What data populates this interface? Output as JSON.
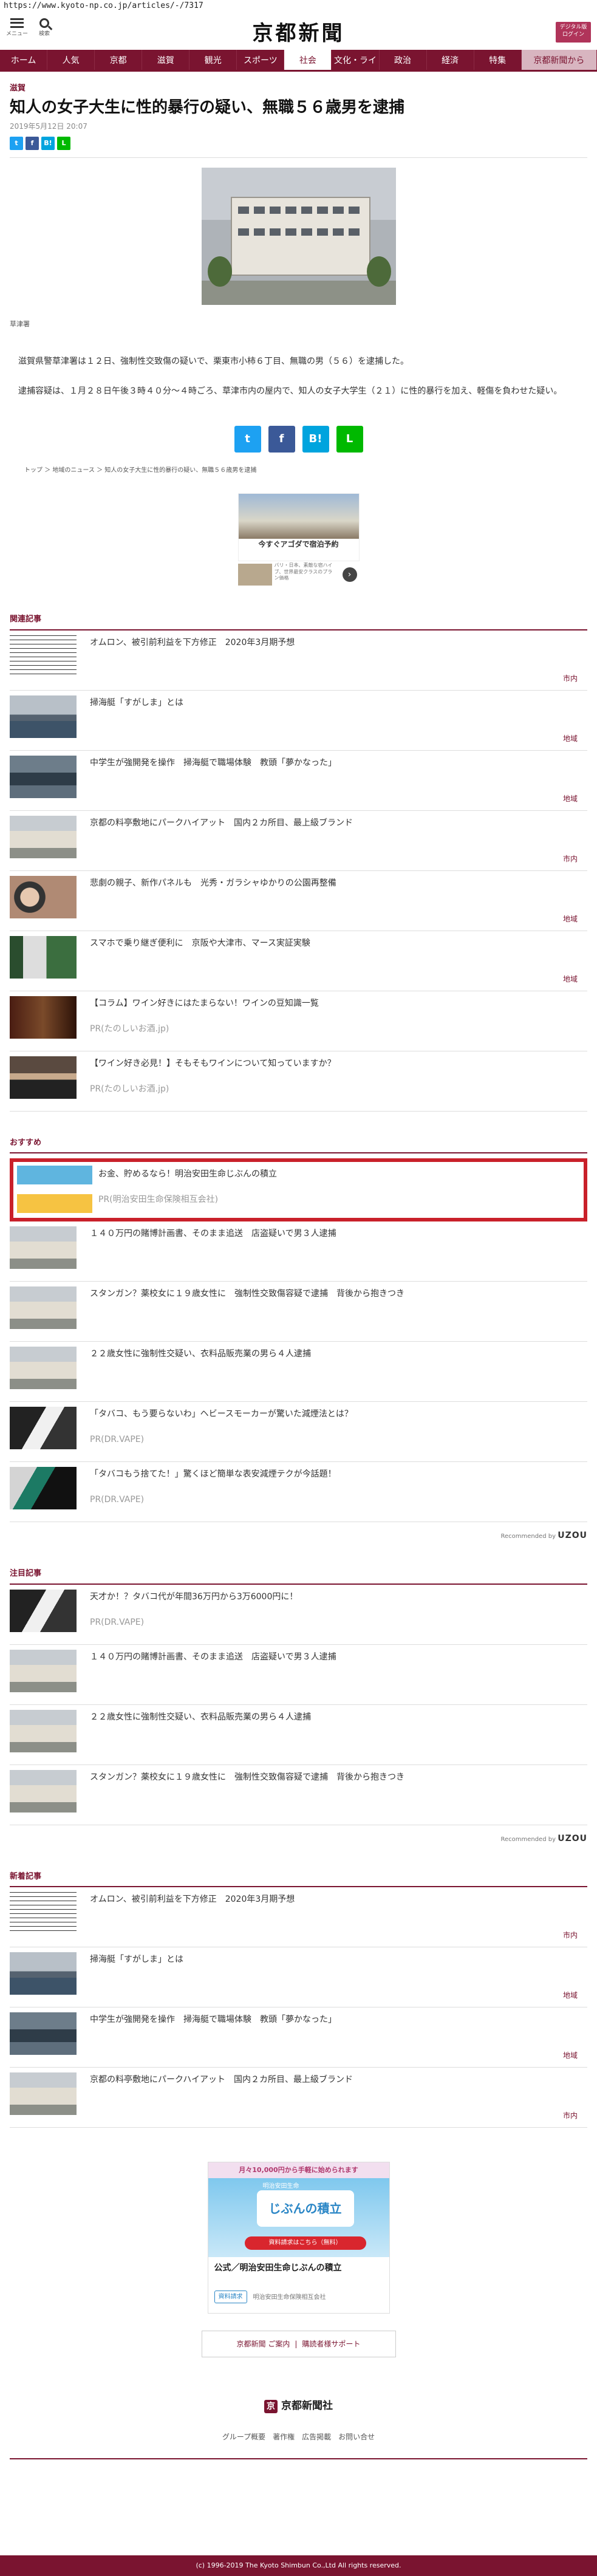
{
  "browser": {
    "url": "https://www.kyoto-np.co.jp/articles/-/7317"
  },
  "header": {
    "menu_label": "メニュー",
    "search_label": "検索",
    "logo": "京都新聞",
    "login_label": "デジタル版\nログイン"
  },
  "nav": {
    "items": [
      "ホーム",
      "人気",
      "京都",
      "滋賀",
      "観光",
      "スポーツ",
      "社会",
      "文化・ライフ",
      "政治",
      "経済",
      "特集",
      "京都新聞から"
    ],
    "active": "社会"
  },
  "article": {
    "category": "滋賀",
    "title": "知人の女子大生に性的暴行の疑い、無職５６歳男を逮捕",
    "date": "2019年5月12日 20:07",
    "share": [
      "t",
      "f",
      "B!",
      "L"
    ],
    "caption": "草津署",
    "paragraphs": [
      "滋賀県警草津署は１２日、強制性交致傷の疑いで、栗東市小柿６丁目、無職の男（５６）を逮捕した。",
      "逮捕容疑は、１月２８日午後３時４０分～４時ごろ、草津市内の屋内で、知人の女子大学生（２１）に性的暴行を加え、軽傷を負わせた疑い。"
    ]
  },
  "breadcrumb": [
    "トップ",
    "＞",
    "地域のニュース",
    "＞",
    "知人の女子大生に性的暴行の疑い、無職５６歳男を逮捕"
  ],
  "ad_top": {
    "headline": "今すぐアゴダで宿泊予約",
    "sub": "バリ・日本、素敵な宿ハイブ、世界最安クラスのプラン価格"
  },
  "related": {
    "heading": "関連記事",
    "items": [
      {
        "title": "オムロン、被引前利益を下方修正　2020年3月期予想",
        "tag": "市内",
        "thumb": "doc"
      },
      {
        "title": "掃海艇「すがしま」とは",
        "tag": "地域",
        "thumb": "ship"
      },
      {
        "title": "中学生が強開発を操作　掃海艇で職場体験　教頭「夢かなった」",
        "tag": "地域",
        "thumb": "ship2"
      },
      {
        "title": "京都の料亭敷地にパークハイアット　国内２カ所目、最上級ブランド",
        "tag": "市内",
        "thumb": "bld"
      },
      {
        "title": "悲劇の親子、新作パネルも　光秀・ガラシャゆかりの公園再整備",
        "tag": "地域",
        "thumb": "doll"
      },
      {
        "title": "スマホで乗り継ぎ便利に　京阪や大津市、マース実証実験",
        "tag": "地域",
        "thumb": "phone"
      },
      {
        "title": "【コラム】ワイン好きにはたまらない！ワインの豆知識一覧",
        "pr": "PR(たのしいお酒.jp)",
        "thumb": "wine"
      },
      {
        "title": "【ワイン好き必見！】そもそもワインについて知っていますか？",
        "pr": "PR(たのしいお酒.jp)",
        "thumb": "man"
      }
    ]
  },
  "recommended": {
    "heading": "おすすめ",
    "items": [
      {
        "title": "お金、貯めるなら！明治安田生命じぶんの積立",
        "pr": "PR(明治安田生命保険相互会社)",
        "thumb": "insur",
        "highlight": true
      },
      {
        "title": "１４０万円の賭博計画書、そのまま追送　店盗疑いで男３人逮捕",
        "thumb": "bld"
      },
      {
        "title": "スタンガン？薬校女に１９歳女性に　強制性交致傷容疑で逮捕　背後から抱きつき",
        "thumb": "bld"
      },
      {
        "title": "２２歳女性に強制性交疑い、衣料品販売業の男ら４人逮捕",
        "thumb": "bld"
      },
      {
        "title": "「タバコ、もう要らないわ」ヘビースモーカーが驚いた減煙法とは？",
        "pr": "PR(DR.VAPE)",
        "thumb": "vape"
      },
      {
        "title": "「タバコもう捨てた！」驚くほど簡単な表安減煙テクが今話題！",
        "pr": "PR(DR.VAPE)",
        "thumb": "vape2"
      }
    ],
    "recommended_by": "Recommended by",
    "uzou": "UZOU"
  },
  "popular": {
    "heading": "注目記事",
    "items": [
      {
        "title": "天才か！？タバコ代が年間36万円から3万6000円に！",
        "pr": "PR(DR.VAPE)",
        "thumb": "vape"
      },
      {
        "title": "１４０万円の賭博計画書、そのまま追送　店盗疑いで男３人逮捕",
        "thumb": "bld"
      },
      {
        "title": "２２歳女性に強制性交疑い、衣料品販売業の男ら４人逮捕",
        "thumb": "bld"
      },
      {
        "title": "スタンガン？薬校女に１９歳女性に　強制性交致傷容疑で逮捕　背後から抱きつき",
        "thumb": "bld"
      }
    ],
    "recommended_by": "Recommended by",
    "uzou": "UZOU"
  },
  "latest": {
    "heading": "新着記事",
    "items": [
      {
        "title": "オムロン、被引前利益を下方修正　2020年3月期予想",
        "tag": "市内",
        "thumb": "doc"
      },
      {
        "title": "掃海艇「すがしま」とは",
        "tag": "地域",
        "thumb": "ship"
      },
      {
        "title": "中学生が強開発を操作　掃海艇で職場体験　教頭「夢かなった」",
        "tag": "地域",
        "thumb": "ship2"
      },
      {
        "title": "京都の料亭敷地にパークハイアット　国内２カ所目、最上級ブランド",
        "tag": "市内",
        "thumb": "bld"
      }
    ]
  },
  "ad_bottom": {
    "banner": "月々10,000円から手軽に始められます",
    "logo": "明治安田生命",
    "product": "じぶんの積立",
    "cta": "資料請求はこちら（無料）",
    "headline": "公式／明治安田生命じぶんの積立",
    "button": "資料請求",
    "sponsor": "明治安田生命保険相互会社"
  },
  "footer": {
    "links": [
      "京都新聞 ご案内",
      "|",
      "購読者様サポート"
    ],
    "brand": "京都新聞社",
    "brand_mark": "京",
    "nav": "グループ概要　著作権　広告掲載　お問い合せ",
    "copyright": "(c) 1996-2019 The Kyoto Shimbun Co.,Ltd All rights reserved."
  }
}
